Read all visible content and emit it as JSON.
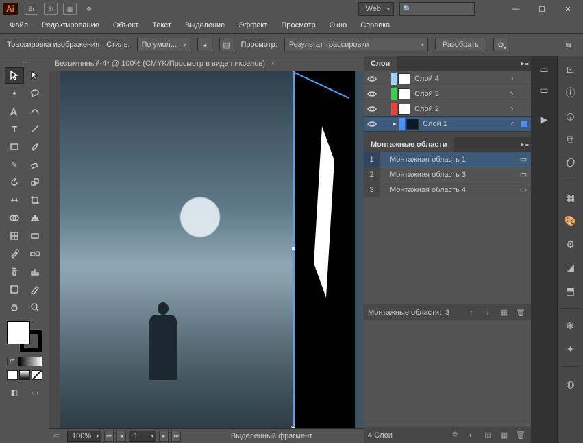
{
  "titlebar": {
    "logo": "Ai",
    "br": "Br",
    "st": "St",
    "workspace": "Web"
  },
  "menu": [
    "Файл",
    "Редактирование",
    "Объект",
    "Текст",
    "Выделение",
    "Эффект",
    "Просмотр",
    "Окно",
    "Справка"
  ],
  "options": {
    "trace_label": "Трассировка изображения",
    "style_label": "Стиль:",
    "style_value": "По умол...",
    "view_label": "Просмотр:",
    "view_value": "Результат трассировки",
    "expand": "Разобрать"
  },
  "doc": {
    "tab": "Безымянный-4* @ 100% (CMYK/Просмотр в виде пикселов)"
  },
  "status": {
    "zoom": "100%",
    "artboard": "1",
    "selection": "Выделенный фрагмент"
  },
  "layers": {
    "title": "Слои",
    "items": [
      {
        "color": "#9ad1ff",
        "name": "Слой 4"
      },
      {
        "color": "#35d24a",
        "name": "Слой 3"
      },
      {
        "color": "#ff3b30",
        "name": "Слой 2"
      },
      {
        "color": "#4a90ff",
        "name": "Слой 1"
      }
    ],
    "footer_count": "4 Слои"
  },
  "artboards": {
    "title": "Монтажные области",
    "items": [
      {
        "n": "1",
        "name": "Монтажная область 1"
      },
      {
        "n": "2",
        "name": "Монтажная область 3"
      },
      {
        "n": "3",
        "name": "Монтажная область 4"
      }
    ],
    "footer_label": "Монтажные области:",
    "footer_count": "3"
  }
}
